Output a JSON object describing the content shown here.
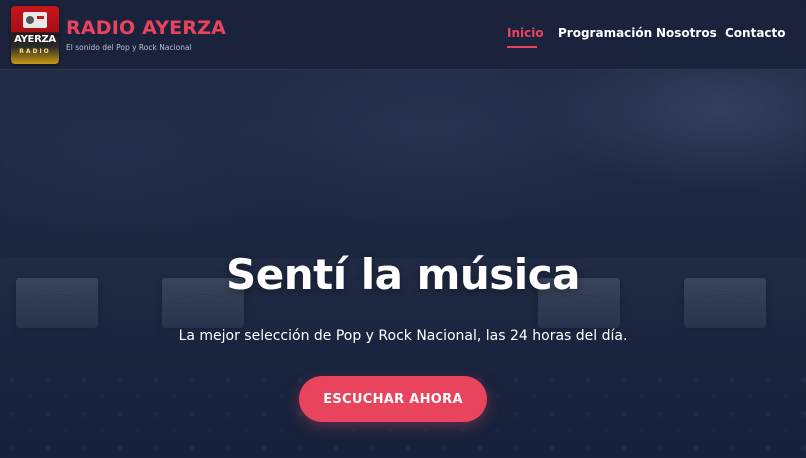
{
  "header": {
    "logo": {
      "word": "AYERZA",
      "sub": "RADIO"
    },
    "brand_title": "RADIO AYERZA",
    "tagline": "El sonido del Pop y Rock Nacional"
  },
  "nav": {
    "items": [
      {
        "label": "Inicio",
        "active": true
      },
      {
        "label": "Programación",
        "active": false
      },
      {
        "label": "Nosotros",
        "active": false
      },
      {
        "label": "Contacto",
        "active": false
      }
    ]
  },
  "hero": {
    "title": "Sentí la música",
    "subtitle": "La mejor selección de Pop y Rock Nacional, las 24 horas del día.",
    "cta_label": "ESCUCHAR AHORA"
  },
  "colors": {
    "accent": "#e9445e",
    "header_bg": "#1a223c",
    "text": "#ffffff"
  }
}
